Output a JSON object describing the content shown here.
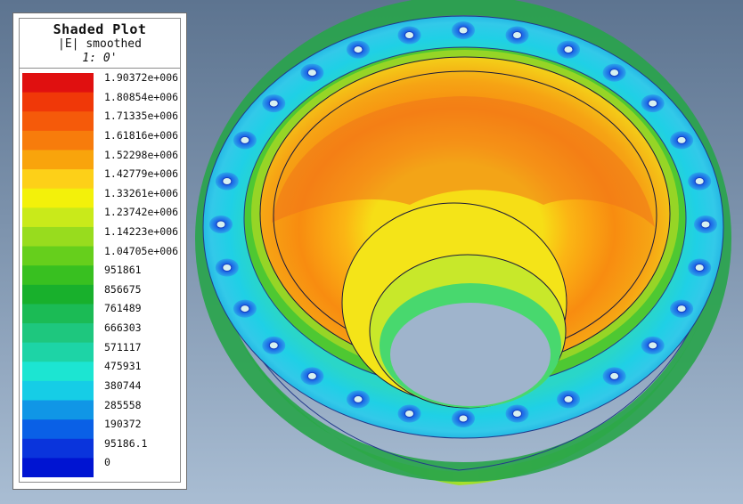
{
  "legend": {
    "title": "Shaded Plot",
    "quantity_mark": "|E|",
    "quantity": "smoothed",
    "step": "1: 0'",
    "colors": [
      "#e01010",
      "#f03808",
      "#f55a0a",
      "#f77c0c",
      "#f9a40c",
      "#fdd018",
      "#f3f10a",
      "#c9ea1a",
      "#98dc1e",
      "#66cf1c",
      "#38c020",
      "#18b02c",
      "#1bbb55",
      "#1ec77e",
      "#1dd4a6",
      "#1ce5d2",
      "#16cde6",
      "#1096e6",
      "#0a60e6",
      "#0a34dc",
      "#0014d2"
    ],
    "labels": [
      "1.90372e+006",
      "1.80854e+006",
      "1.71335e+006",
      "1.61816e+006",
      "1.52298e+006",
      "1.42779e+006",
      "1.33261e+006",
      "1.23742e+006",
      "1.14223e+006",
      "1.04705e+006",
      "951861",
      "856675",
      "761489",
      "666303",
      "571117",
      "475931",
      "380744",
      "285558",
      "190372",
      "95186.1",
      "0"
    ]
  }
}
